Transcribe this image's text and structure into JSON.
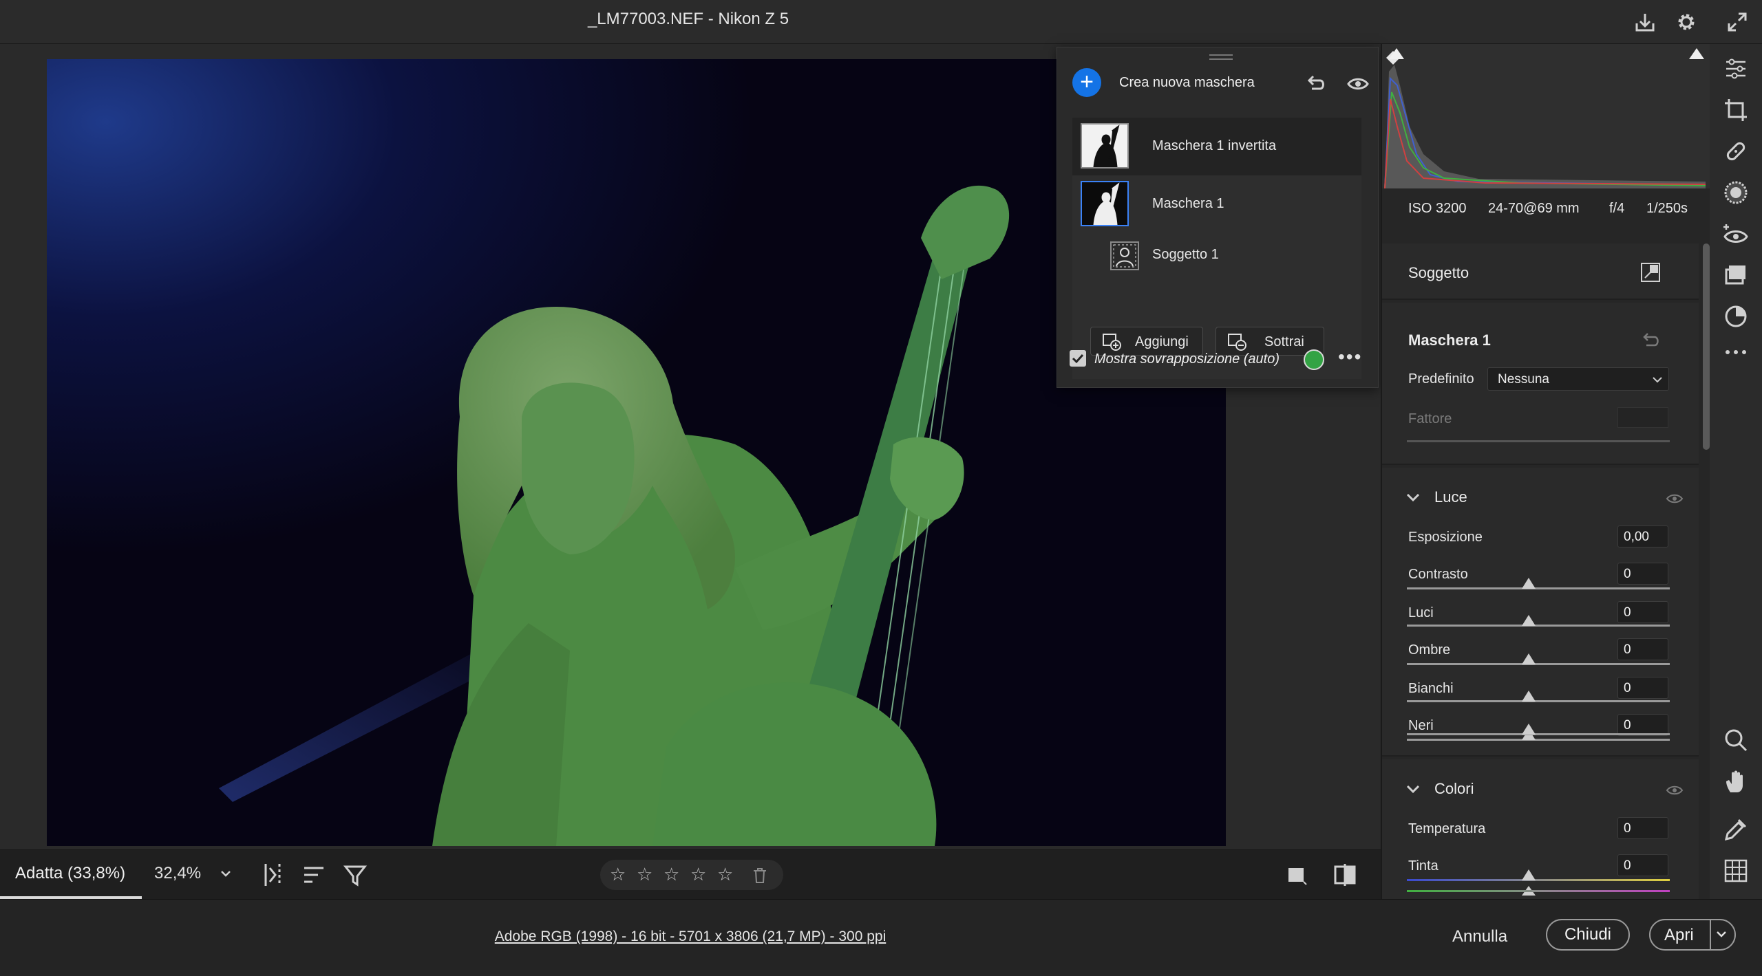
{
  "window": {
    "title": "_LM77003.NEF  -  Nikon Z 5"
  },
  "canvas_toolbar": {
    "zoom_fit": "Adatta (33,8%)",
    "zoom_pct": "32,4%",
    "rating_stars": [
      "☆",
      "☆",
      "☆",
      "☆",
      "☆"
    ]
  },
  "mask_panel": {
    "add_symbol": "+",
    "create_label": "Crea nuova maschera",
    "masks": [
      {
        "label": "Maschera 1 invertita"
      },
      {
        "label": "Maschera 1"
      }
    ],
    "subject_row": {
      "label": "Soggetto 1"
    },
    "add_button": "Aggiungi",
    "subtract_button": "Sottrai",
    "overlay_label": "Mostra sovrapposizione (auto)",
    "overlay_color": "#33a344",
    "more": "•••"
  },
  "histogram": {
    "iso": "ISO 3200",
    "lens": "24-70@69 mm",
    "aperture": "f/4",
    "shutter": "1/250s"
  },
  "panel": {
    "subject_title": "Soggetto",
    "mask_title": "Maschera 1",
    "preset_label": "Predefinito",
    "preset_value": "Nessuna",
    "factor_label": "Fattore",
    "light": {
      "title": "Luce",
      "sliders": [
        {
          "label": "Esposizione",
          "value": "0,00"
        },
        {
          "label": "Contrasto",
          "value": "0"
        },
        {
          "label": "Luci",
          "value": "0"
        },
        {
          "label": "Ombre",
          "value": "0"
        },
        {
          "label": "Bianchi",
          "value": "0"
        },
        {
          "label": "Neri",
          "value": "0"
        }
      ]
    },
    "color": {
      "title": "Colori",
      "sliders": [
        {
          "label": "Temperatura",
          "value": "0"
        },
        {
          "label": "Tinta",
          "value": "0"
        }
      ]
    }
  },
  "footer": {
    "info": "Adobe RGB (1998) - 16 bit - 5701 x 3806 (21,7 MP) - 300 ppi",
    "cancel": "Annulla",
    "close": "Chiudi",
    "open": "Apri"
  },
  "colors": {
    "accent": "#1473e6",
    "mask_overlay": "#4f9a45"
  }
}
